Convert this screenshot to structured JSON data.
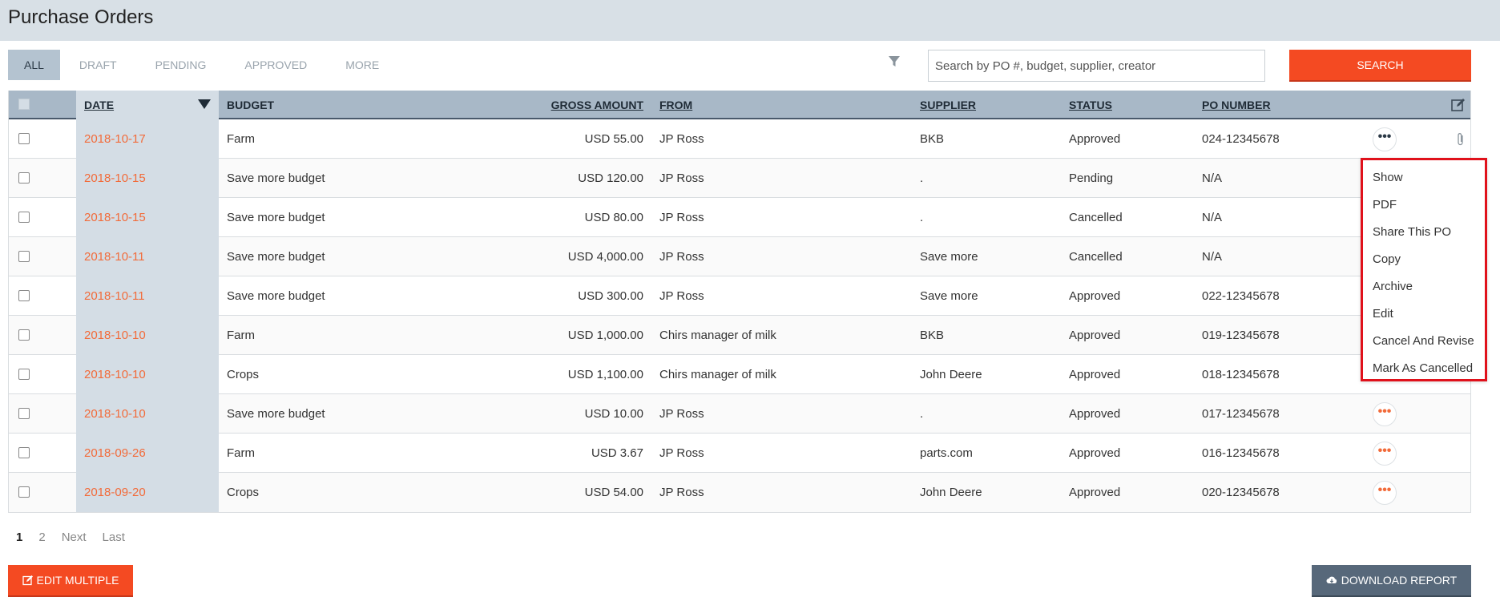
{
  "page": {
    "title": "Purchase Orders"
  },
  "tabs": [
    {
      "label": "ALL",
      "active": true
    },
    {
      "label": "DRAFT",
      "active": false
    },
    {
      "label": "PENDING",
      "active": false
    },
    {
      "label": "APPROVED",
      "active": false
    },
    {
      "label": "MORE",
      "active": false
    }
  ],
  "search": {
    "placeholder": "Search by PO #, budget, supplier, creator",
    "button_label": "SEARCH"
  },
  "table": {
    "columns": {
      "date": "DATE",
      "budget": "BUDGET",
      "gross_amount": "GROSS AMOUNT",
      "from": "FROM",
      "supplier": "SUPPLIER",
      "status": "STATUS",
      "po_number": "PO NUMBER"
    },
    "rows": [
      {
        "date": "2018-10-17",
        "budget": "Farm",
        "amount": "USD 55.00",
        "from": "JP Ross",
        "supplier": "BKB",
        "status": "Approved",
        "po": "024-12345678"
      },
      {
        "date": "2018-10-15",
        "budget": "Save more budget",
        "amount": "USD 120.00",
        "from": "JP Ross",
        "supplier": ".",
        "status": "Pending",
        "po": "N/A"
      },
      {
        "date": "2018-10-15",
        "budget": "Save more budget",
        "amount": "USD 80.00",
        "from": "JP Ross",
        "supplier": ".",
        "status": "Cancelled",
        "po": "N/A"
      },
      {
        "date": "2018-10-11",
        "budget": "Save more budget",
        "amount": "USD 4,000.00",
        "from": "JP Ross",
        "supplier": "Save more",
        "status": "Cancelled",
        "po": "N/A"
      },
      {
        "date": "2018-10-11",
        "budget": "Save more budget",
        "amount": "USD 300.00",
        "from": "JP Ross",
        "supplier": "Save more",
        "status": "Approved",
        "po": "022-12345678"
      },
      {
        "date": "2018-10-10",
        "budget": "Farm",
        "amount": "USD 1,000.00",
        "from": "Chirs manager of milk",
        "supplier": "BKB",
        "status": "Approved",
        "po": "019-12345678"
      },
      {
        "date": "2018-10-10",
        "budget": "Crops",
        "amount": "USD 1,100.00",
        "from": "Chirs manager of milk",
        "supplier": "John Deere",
        "status": "Approved",
        "po": "018-12345678"
      },
      {
        "date": "2018-10-10",
        "budget": "Save more budget",
        "amount": "USD 10.00",
        "from": "JP Ross",
        "supplier": ".",
        "status": "Approved",
        "po": "017-12345678"
      },
      {
        "date": "2018-09-26",
        "budget": "Farm",
        "amount": "USD 3.67",
        "from": "JP Ross",
        "supplier": "parts.com",
        "status": "Approved",
        "po": "016-12345678"
      },
      {
        "date": "2018-09-20",
        "budget": "Crops",
        "amount": "USD 54.00",
        "from": "JP Ross",
        "supplier": "John Deere",
        "status": "Approved",
        "po": "020-12345678"
      }
    ]
  },
  "row_menu": {
    "items": [
      "Show",
      "PDF",
      "Share This PO",
      "Copy",
      "Archive",
      "Edit",
      "Cancel And Revise",
      "Mark As Cancelled"
    ]
  },
  "pagination": {
    "pages": [
      "1",
      "2"
    ],
    "next": "Next",
    "last": "Last"
  },
  "footer": {
    "edit_multiple": "EDIT MULTIPLE",
    "download_report": "DOWNLOAD REPORT"
  },
  "colors": {
    "accent": "#f44a22",
    "date_link": "#f26b3a",
    "header_bg": "#a8b8c7",
    "menu_border": "#e0111b"
  }
}
